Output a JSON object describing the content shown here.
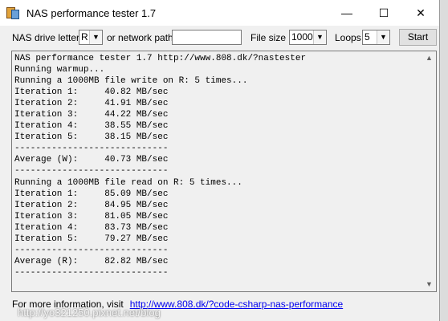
{
  "window": {
    "title": "NAS performance tester 1.7",
    "controls": {
      "minimize": "—",
      "maximize": "☐",
      "close": "✕"
    }
  },
  "toolbar": {
    "drive_label": "NAS drive letter",
    "drive_value": "R",
    "network_label": "or network path",
    "network_value": "",
    "filesize_label": "File size",
    "filesize_value": "1000",
    "loops_label": "Loops",
    "loops_value": "5",
    "start_label": "Start"
  },
  "output": {
    "lines": "NAS performance tester 1.7 http://www.808.dk/?nastester\nRunning warmup...\nRunning a 1000MB file write on R: 5 times...\nIteration 1:     40.82 MB/sec\nIteration 2:     41.91 MB/sec\nIteration 3:     44.22 MB/sec\nIteration 4:     38.55 MB/sec\nIteration 5:     38.15 MB/sec\n-----------------------------\nAverage (W):     40.73 MB/sec\n-----------------------------\nRunning a 1000MB file read on R: 5 times...\nIteration 1:     85.09 MB/sec\nIteration 2:     84.95 MB/sec\nIteration 3:     81.05 MB/sec\nIteration 4:     83.73 MB/sec\nIteration 5:     79.27 MB/sec\n-----------------------------\nAverage (R):     82.82 MB/sec\n-----------------------------"
  },
  "footer": {
    "text": "For more information, visit",
    "link": "http://www.808.dk/?code-csharp-nas-performance"
  },
  "watermark": "http://yo321250.pixnet.net/blog"
}
